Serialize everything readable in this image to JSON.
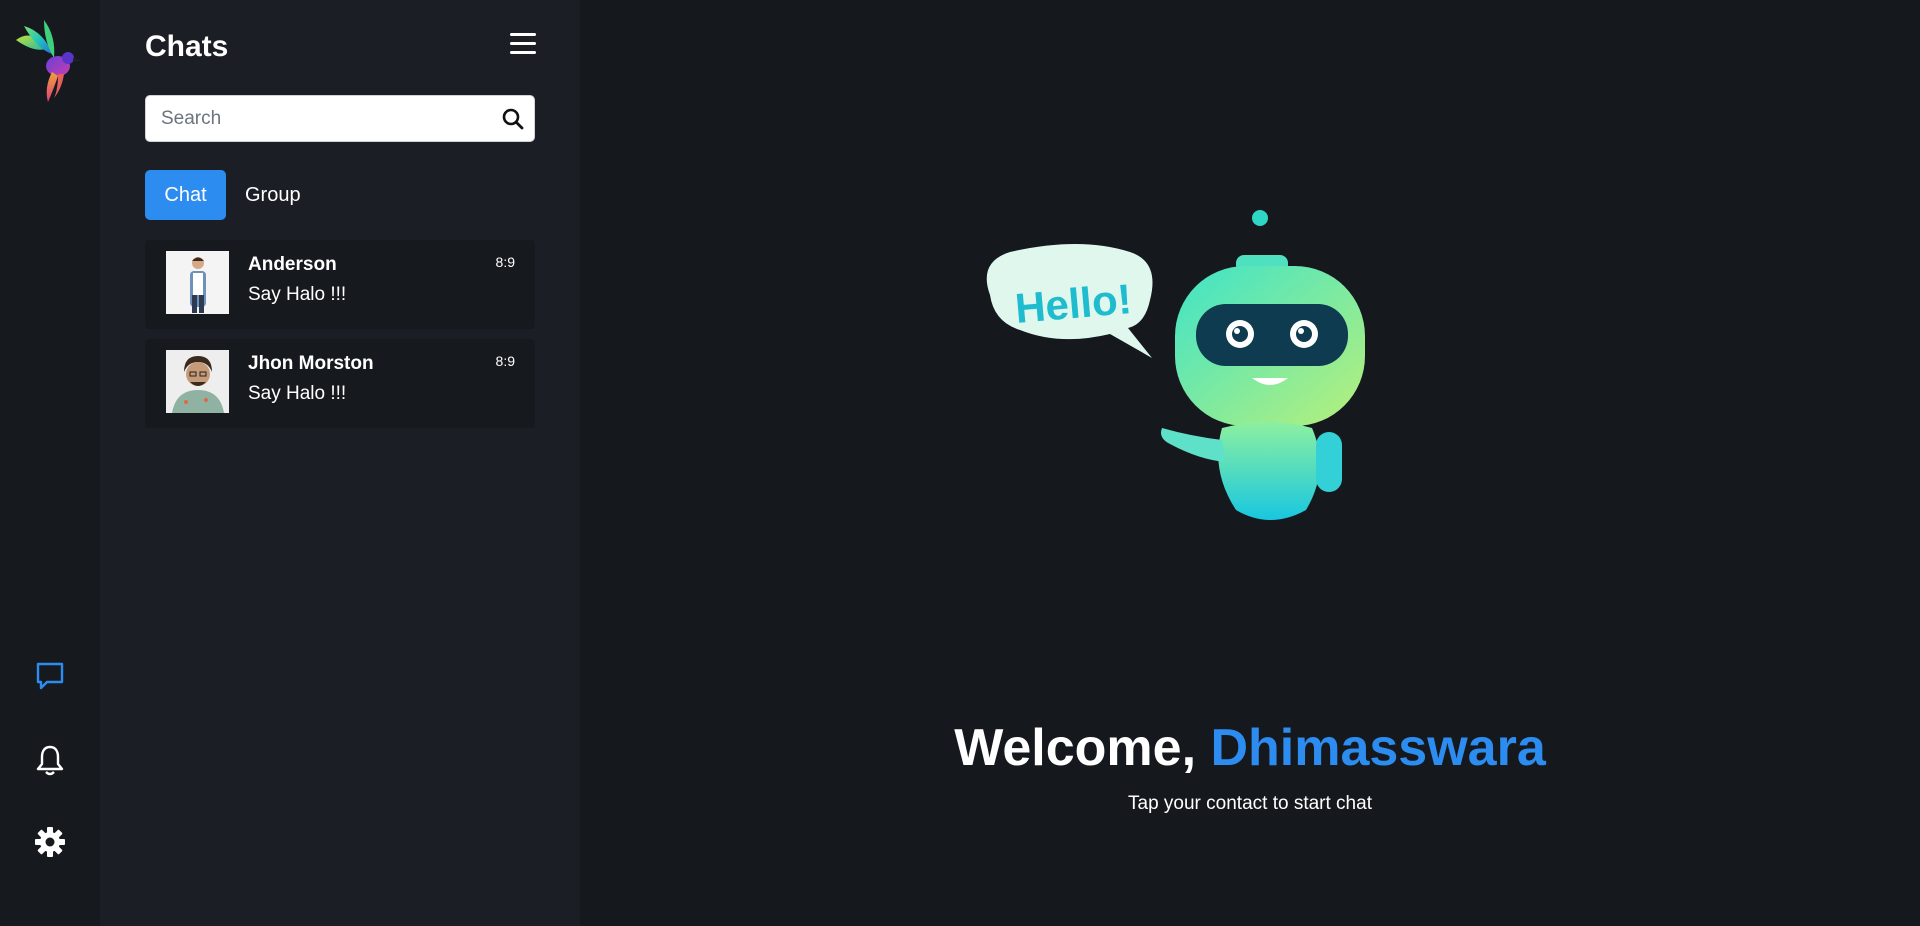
{
  "sidebar": {
    "icons": [
      "logo-bird",
      "chat-bubble-icon",
      "bell-icon",
      "gear-icon"
    ],
    "active_color": "#2d8cf0"
  },
  "panel": {
    "title": "Chats",
    "search": {
      "placeholder": "Search",
      "value": ""
    },
    "tabs": [
      {
        "label": "Chat",
        "active": true
      },
      {
        "label": "Group",
        "active": false
      }
    ],
    "chats": [
      {
        "name": "Anderson",
        "message": "Say Halo !!!",
        "time": "8:9"
      },
      {
        "name": "Jhon Morston",
        "message": "Say Halo !!!",
        "time": "8:9"
      }
    ]
  },
  "main": {
    "welcome_prefix": "Welcome, ",
    "username": "Dhimasswara",
    "subtitle": "Tap your contact to start chat",
    "robot_bubble": "Hello!"
  },
  "colors": {
    "accent": "#2d8cf0",
    "background": "#15191e",
    "panel": "#1b1f25"
  }
}
